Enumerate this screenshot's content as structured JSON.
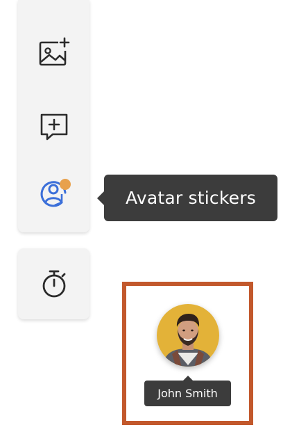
{
  "toolbar": {
    "items": [
      {
        "icon": "add-image-icon"
      },
      {
        "icon": "add-comment-icon"
      },
      {
        "icon": "avatar-sticker-icon",
        "badge_color": "#e8a14c",
        "accent": "#3b6fd9"
      },
      {
        "icon": "timer-icon"
      }
    ]
  },
  "tooltip": {
    "text": "Avatar stickers"
  },
  "avatar_sticker": {
    "name": "John Smith",
    "background_color": "#e3b238",
    "highlight_color": "#c2582c"
  }
}
